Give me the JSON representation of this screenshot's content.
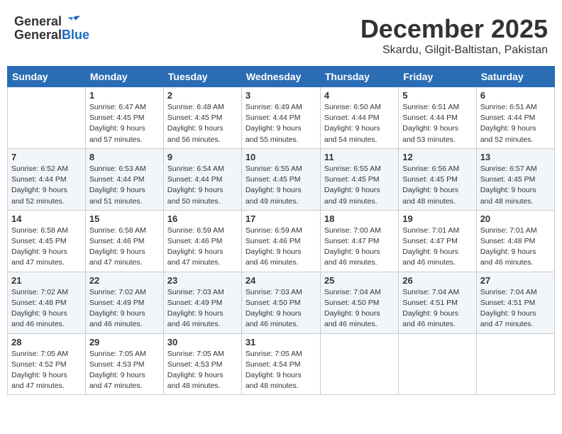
{
  "header": {
    "logo_general": "General",
    "logo_blue": "Blue",
    "title": "December 2025",
    "location": "Skardu, Gilgit-Baltistan, Pakistan"
  },
  "days_of_week": [
    "Sunday",
    "Monday",
    "Tuesday",
    "Wednesday",
    "Thursday",
    "Friday",
    "Saturday"
  ],
  "weeks": [
    [
      {
        "day": "",
        "info": ""
      },
      {
        "day": "1",
        "info": "Sunrise: 6:47 AM\nSunset: 4:45 PM\nDaylight: 9 hours\nand 57 minutes."
      },
      {
        "day": "2",
        "info": "Sunrise: 6:48 AM\nSunset: 4:45 PM\nDaylight: 9 hours\nand 56 minutes."
      },
      {
        "day": "3",
        "info": "Sunrise: 6:49 AM\nSunset: 4:44 PM\nDaylight: 9 hours\nand 55 minutes."
      },
      {
        "day": "4",
        "info": "Sunrise: 6:50 AM\nSunset: 4:44 PM\nDaylight: 9 hours\nand 54 minutes."
      },
      {
        "day": "5",
        "info": "Sunrise: 6:51 AM\nSunset: 4:44 PM\nDaylight: 9 hours\nand 53 minutes."
      },
      {
        "day": "6",
        "info": "Sunrise: 6:51 AM\nSunset: 4:44 PM\nDaylight: 9 hours\nand 52 minutes."
      }
    ],
    [
      {
        "day": "7",
        "info": "Sunrise: 6:52 AM\nSunset: 4:44 PM\nDaylight: 9 hours\nand 52 minutes."
      },
      {
        "day": "8",
        "info": "Sunrise: 6:53 AM\nSunset: 4:44 PM\nDaylight: 9 hours\nand 51 minutes."
      },
      {
        "day": "9",
        "info": "Sunrise: 6:54 AM\nSunset: 4:44 PM\nDaylight: 9 hours\nand 50 minutes."
      },
      {
        "day": "10",
        "info": "Sunrise: 6:55 AM\nSunset: 4:45 PM\nDaylight: 9 hours\nand 49 minutes."
      },
      {
        "day": "11",
        "info": "Sunrise: 6:55 AM\nSunset: 4:45 PM\nDaylight: 9 hours\nand 49 minutes."
      },
      {
        "day": "12",
        "info": "Sunrise: 6:56 AM\nSunset: 4:45 PM\nDaylight: 9 hours\nand 48 minutes."
      },
      {
        "day": "13",
        "info": "Sunrise: 6:57 AM\nSunset: 4:45 PM\nDaylight: 9 hours\nand 48 minutes."
      }
    ],
    [
      {
        "day": "14",
        "info": "Sunrise: 6:58 AM\nSunset: 4:45 PM\nDaylight: 9 hours\nand 47 minutes."
      },
      {
        "day": "15",
        "info": "Sunrise: 6:58 AM\nSunset: 4:46 PM\nDaylight: 9 hours\nand 47 minutes."
      },
      {
        "day": "16",
        "info": "Sunrise: 6:59 AM\nSunset: 4:46 PM\nDaylight: 9 hours\nand 47 minutes."
      },
      {
        "day": "17",
        "info": "Sunrise: 6:59 AM\nSunset: 4:46 PM\nDaylight: 9 hours\nand 46 minutes."
      },
      {
        "day": "18",
        "info": "Sunrise: 7:00 AM\nSunset: 4:47 PM\nDaylight: 9 hours\nand 46 minutes."
      },
      {
        "day": "19",
        "info": "Sunrise: 7:01 AM\nSunset: 4:47 PM\nDaylight: 9 hours\nand 46 minutes."
      },
      {
        "day": "20",
        "info": "Sunrise: 7:01 AM\nSunset: 4:48 PM\nDaylight: 9 hours\nand 46 minutes."
      }
    ],
    [
      {
        "day": "21",
        "info": "Sunrise: 7:02 AM\nSunset: 4:48 PM\nDaylight: 9 hours\nand 46 minutes."
      },
      {
        "day": "22",
        "info": "Sunrise: 7:02 AM\nSunset: 4:49 PM\nDaylight: 9 hours\nand 46 minutes."
      },
      {
        "day": "23",
        "info": "Sunrise: 7:03 AM\nSunset: 4:49 PM\nDaylight: 9 hours\nand 46 minutes."
      },
      {
        "day": "24",
        "info": "Sunrise: 7:03 AM\nSunset: 4:50 PM\nDaylight: 9 hours\nand 46 minutes."
      },
      {
        "day": "25",
        "info": "Sunrise: 7:04 AM\nSunset: 4:50 PM\nDaylight: 9 hours\nand 46 minutes."
      },
      {
        "day": "26",
        "info": "Sunrise: 7:04 AM\nSunset: 4:51 PM\nDaylight: 9 hours\nand 46 minutes."
      },
      {
        "day": "27",
        "info": "Sunrise: 7:04 AM\nSunset: 4:51 PM\nDaylight: 9 hours\nand 47 minutes."
      }
    ],
    [
      {
        "day": "28",
        "info": "Sunrise: 7:05 AM\nSunset: 4:52 PM\nDaylight: 9 hours\nand 47 minutes."
      },
      {
        "day": "29",
        "info": "Sunrise: 7:05 AM\nSunset: 4:53 PM\nDaylight: 9 hours\nand 47 minutes."
      },
      {
        "day": "30",
        "info": "Sunrise: 7:05 AM\nSunset: 4:53 PM\nDaylight: 9 hours\nand 48 minutes."
      },
      {
        "day": "31",
        "info": "Sunrise: 7:05 AM\nSunset: 4:54 PM\nDaylight: 9 hours\nand 48 minutes."
      },
      {
        "day": "",
        "info": ""
      },
      {
        "day": "",
        "info": ""
      },
      {
        "day": "",
        "info": ""
      }
    ]
  ]
}
